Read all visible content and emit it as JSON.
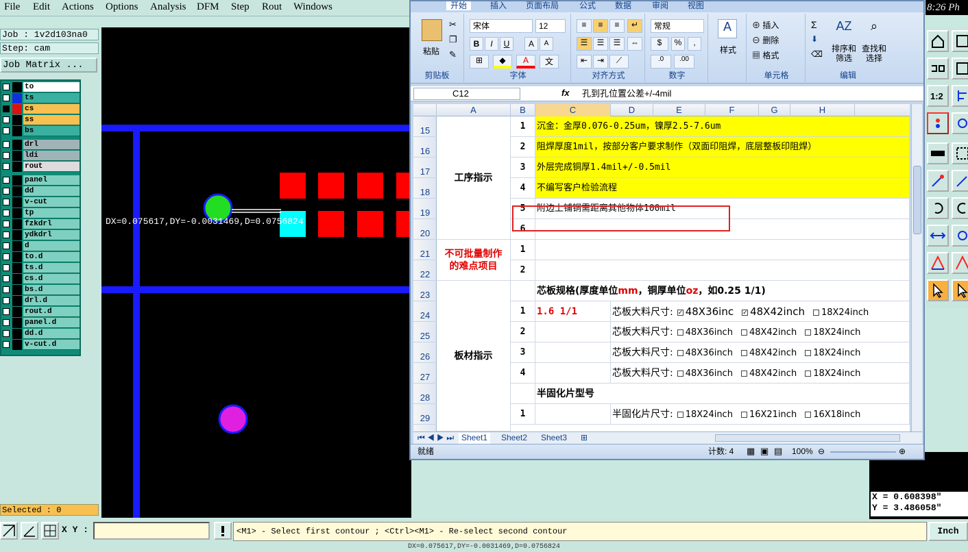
{
  "cam": {
    "menu": [
      "File",
      "Edit",
      "Actions",
      "Options",
      "Analysis",
      "DFM",
      "Step",
      "Rout",
      "Windows"
    ],
    "job_label": "Job : 1v2d103na0",
    "step_label": "Step: cam",
    "job_matrix_button": "Job Matrix ...",
    "layers": [
      {
        "name": "to",
        "color": "#000000",
        "bg": "#ffffff"
      },
      {
        "name": "ts",
        "color": "#1030e0",
        "bg": "#3ab0a0"
      },
      {
        "name": "cs",
        "color": "#e01010",
        "bg": "#f8c050",
        "active": true
      },
      {
        "name": "ss",
        "color": "#000000",
        "bg": "#f8c050"
      },
      {
        "name": "bs",
        "color": "#000000",
        "bg": "#3ab0a0"
      },
      {
        "name": "drl",
        "color": "#000000",
        "bg": "#a0b4b8"
      },
      {
        "name": "ldi",
        "color": "#000000",
        "bg": "#a0b4b8"
      },
      {
        "name": "rout",
        "color": "#000000",
        "bg": "#dcdcdc"
      },
      {
        "name": "panel",
        "color": "#000000",
        "bg": "#7fd0c0"
      },
      {
        "name": "dd",
        "color": "#000000",
        "bg": "#7fd0c0"
      },
      {
        "name": "v-cut",
        "color": "#000000",
        "bg": "#7fd0c0"
      },
      {
        "name": "tp",
        "color": "#000000",
        "bg": "#7fd0c0"
      },
      {
        "name": "fzkdrl",
        "color": "#000000",
        "bg": "#7fd0c0"
      },
      {
        "name": "ydkdrl",
        "color": "#000000",
        "bg": "#7fd0c0"
      },
      {
        "name": "d",
        "color": "#000000",
        "bg": "#7fd0c0"
      },
      {
        "name": "to.d",
        "color": "#000000",
        "bg": "#7fd0c0"
      },
      {
        "name": "ts.d",
        "color": "#000000",
        "bg": "#7fd0c0"
      },
      {
        "name": "cs.d",
        "color": "#000000",
        "bg": "#7fd0c0"
      },
      {
        "name": "bs.d",
        "color": "#000000",
        "bg": "#7fd0c0"
      },
      {
        "name": "drl.d",
        "color": "#000000",
        "bg": "#7fd0c0"
      },
      {
        "name": "rout.d",
        "color": "#000000",
        "bg": "#7fd0c0"
      },
      {
        "name": "panel.d",
        "color": "#000000",
        "bg": "#7fd0c0"
      },
      {
        "name": "dd.d",
        "color": "#000000",
        "bg": "#7fd0c0"
      },
      {
        "name": "v-cut.d",
        "color": "#000000",
        "bg": "#7fd0c0"
      }
    ],
    "selected_label": "Selected : 0",
    "measure_text": "DX=0.075617,DY=-0.0031469,D=0.0756824",
    "clock": "8:26 Ph",
    "coord_x": "X = 0.608398\"",
    "coord_y": "Y = 3.486058\"",
    "xy_label": "X Y :",
    "xy_value": "",
    "prompt": "<M1> - Select first contour ; <Ctrl><M1> - Re-select second contour",
    "units": "Inch",
    "status_line": "DX=0.075617,DY=-0.0031469,D=0.0756824"
  },
  "excel": {
    "tabs": [
      "开始",
      "插入",
      "页面布局",
      "公式",
      "数据",
      "审阅",
      "视图"
    ],
    "groups": {
      "clipboard": {
        "label": "剪贴板",
        "paste": "粘贴"
      },
      "font": {
        "label": "字体",
        "font_name": "宋体",
        "font_size": "12"
      },
      "alignment": {
        "label": "对齐方式"
      },
      "number": {
        "label": "数字",
        "format": "常规"
      },
      "styles": {
        "label": "样式"
      },
      "cells": {
        "label": "单元格",
        "insert": "插入",
        "delete": "删除",
        "format": "格式"
      },
      "editing": {
        "label": "编辑",
        "sort": "排序和\n筛选",
        "find": "查找和\n选择"
      }
    },
    "name_box": "C12",
    "fx": "fx",
    "formula": "孔到孔位置公差+/-4mil",
    "columns": [
      "A",
      "B",
      "C",
      "D",
      "E",
      "F",
      "G",
      "H"
    ],
    "rows": [
      "15",
      "16",
      "17",
      "18",
      "19",
      "20",
      "21",
      "22",
      "23",
      "24",
      "25",
      "26",
      "27",
      "28",
      "29"
    ],
    "section_process": "工序指示",
    "section_hard": "不可批量制作\n的难点项目",
    "section_board": "板材指示",
    "process_items": [
      {
        "n": "1",
        "text": "沉金：金厚0.076-0.25um，镍厚2.5-7.6um"
      },
      {
        "n": "2",
        "text": "阻焊厚度1mil，按部分客户要求制作（双面印阻焊，底层整板印阻焊）"
      },
      {
        "n": "3",
        "text": "外层完成铜厚1.4mil+/-0.5mil"
      },
      {
        "n": "4",
        "text": "不编写客户检验流程"
      },
      {
        "n": "5",
        "text": "附边上铺铜需距离其他物体100mil"
      },
      {
        "n": "6",
        "text": ""
      }
    ],
    "hard_items": [
      {
        "n": "1"
      },
      {
        "n": "2"
      }
    ],
    "core_title_a": "芯板规格(厚度单位",
    "core_title_mm": "mm",
    "core_title_b": "，铜厚单位",
    "core_title_oz": "oz",
    "core_title_c": "，如0.25 1/1)",
    "core_rows": [
      {
        "n": "1",
        "spec": "1.6 1/1",
        "label": "芯板大料尺寸:",
        "opts": [
          {
            "t": "48X36inc",
            "c": true
          },
          {
            "t": "48X42inch",
            "c": true
          },
          {
            "t": "18X24inch",
            "c": false
          }
        ]
      },
      {
        "n": "2",
        "spec": "",
        "label": "芯板大料尺寸:",
        "opts": [
          {
            "t": "48X36inch",
            "c": false
          },
          {
            "t": "48X42inch",
            "c": false
          },
          {
            "t": "18X24inch",
            "c": false
          }
        ]
      },
      {
        "n": "3",
        "spec": "",
        "label": "芯板大料尺寸:",
        "opts": [
          {
            "t": "48X36inch",
            "c": false
          },
          {
            "t": "48X42inch",
            "c": false
          },
          {
            "t": "18X24inch",
            "c": false
          }
        ]
      },
      {
        "n": "4",
        "spec": "",
        "label": "芯板大料尺寸:",
        "opts": [
          {
            "t": "48X36inch",
            "c": false
          },
          {
            "t": "48X42inch",
            "c": false
          },
          {
            "t": "18X24inch",
            "c": false
          }
        ]
      }
    ],
    "prepreg_title": "半固化片型号",
    "prepreg_row": {
      "n": "1",
      "label": "半固化片尺寸:",
      "opts": [
        "18X24inch",
        "16X21inch",
        "16X18inch"
      ]
    },
    "sheets": [
      "Sheet1",
      "Sheet2",
      "Sheet3"
    ],
    "status_ready": "就绪",
    "status_count": "计数: 4",
    "zoom": "100%"
  }
}
